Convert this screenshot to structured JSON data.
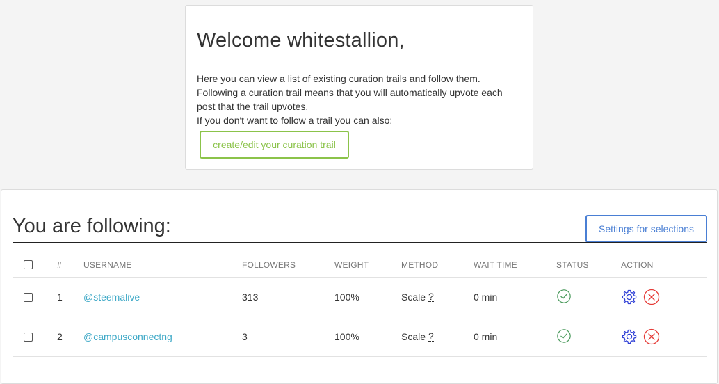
{
  "welcome": {
    "title": "Welcome whitestallion,",
    "line1": "Here you can view a list of existing curation trails and follow them.",
    "line2": "Following a curation trail means that you will automatically upvote each post that the trail upvotes.",
    "line3": "If you don't want to follow a trail you can also:",
    "create_button": "create/edit your curation trail"
  },
  "following": {
    "title": "You are following:",
    "settings_button": "Settings for selections",
    "columns": {
      "num": "#",
      "username": "USERNAME",
      "followers": "FOLLOWERS",
      "weight": "WEIGHT",
      "method": "METHOD",
      "wait_time": "WAIT TIME",
      "status": "STATUS",
      "action": "ACTION"
    },
    "rows": [
      {
        "num": "1",
        "username": "@steemalive",
        "followers": "313",
        "weight": "100%",
        "method": "Scale",
        "method_hint": "?",
        "wait_time": "0 min",
        "status": "active"
      },
      {
        "num": "2",
        "username": "@campusconnectng",
        "followers": "3",
        "weight": "100%",
        "method": "Scale",
        "method_hint": "?",
        "wait_time": "0 min",
        "status": "active"
      }
    ]
  },
  "colors": {
    "accent_green": "#8bc34a",
    "accent_blue": "#4a7fd4",
    "link": "#3fa9c7",
    "status_ok": "#4a9a5c",
    "delete_red": "#e53935",
    "gear_blue": "#2f3fd6"
  },
  "icons": {
    "status": "check-circle-icon",
    "settings": "gear-icon",
    "delete": "close-circle-icon"
  }
}
